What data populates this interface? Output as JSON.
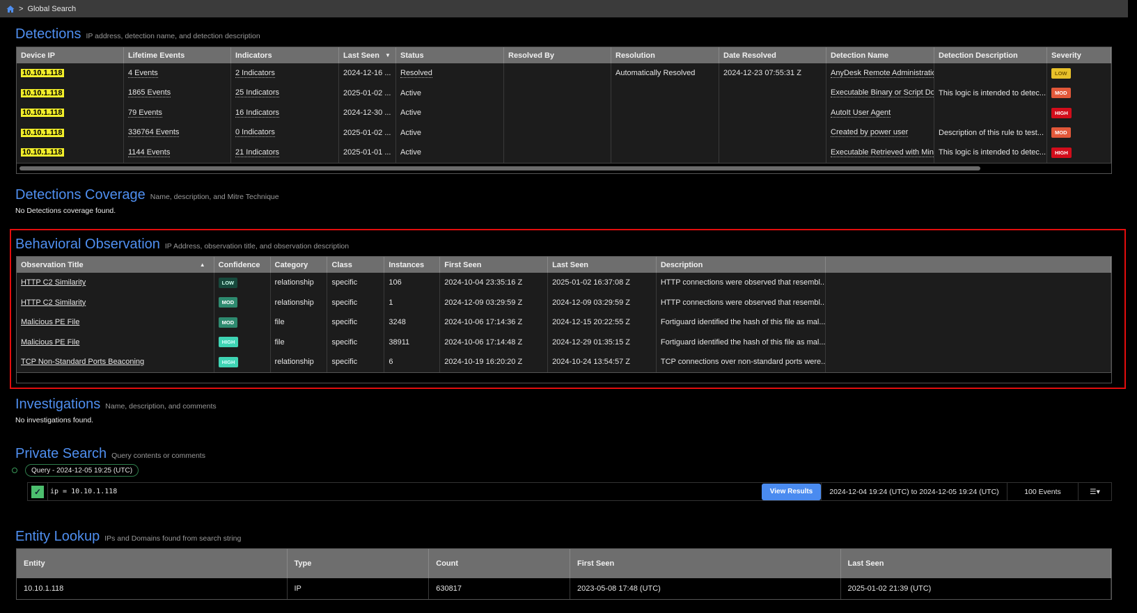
{
  "breadcrumb": {
    "current": "Global Search"
  },
  "detections": {
    "title": "Detections",
    "subtitle": "IP address, detection name, and detection description",
    "columns": [
      "Device IP",
      "Lifetime Events",
      "Indicators",
      "Last Seen",
      "Status",
      "Resolved By",
      "Resolution",
      "Date Resolved",
      "Detection Name",
      "Detection Description",
      "Severity"
    ],
    "rows": [
      [
        "10.10.1.118",
        "4 Events",
        "2 Indicators",
        "2024-12-16 ...",
        "Resolved",
        "",
        "Automatically Resolved",
        "2024-12-23 07:55:31 Z",
        "AnyDesk Remote Administratio",
        "",
        "LOW"
      ],
      [
        "10.10.1.118",
        "1865 Events",
        "25 Indicators",
        "2025-01-02 ...",
        "Active",
        "",
        "",
        "",
        "Executable Binary or Script Dow",
        "This logic is intended to detec...",
        "MOD"
      ],
      [
        "10.10.1.118",
        "79 Events",
        "16 Indicators",
        "2024-12-30 ...",
        "Active",
        "",
        "",
        "",
        "AutoIt User Agent",
        "",
        "HIGH"
      ],
      [
        "10.10.1.118",
        "336764 Events",
        "0 Indicators",
        "2025-01-02 ...",
        "Active",
        "",
        "",
        "",
        "Created by power user",
        "Description of this rule to test...",
        "MOD"
      ],
      [
        "10.10.1.118",
        "1144 Events",
        "21 Indicators",
        "2025-01-01 ...",
        "Active",
        "",
        "",
        "",
        "Executable Retrieved with Minir",
        "This logic is intended to detec...",
        "HIGH"
      ]
    ]
  },
  "coverage": {
    "title": "Detections Coverage",
    "subtitle": "Name, description, and Mitre Technique",
    "empty": "No Detections coverage found."
  },
  "behavioral": {
    "title": "Behavioral Observation",
    "subtitle": "IP Address, observation title, and observation description",
    "columns": [
      "Observation Title",
      "Confidence",
      "Category",
      "Class",
      "Instances",
      "First Seen",
      "Last Seen",
      "Description",
      ""
    ],
    "rows": [
      [
        "HTTP C2 Similarity",
        "LOW",
        "relationship",
        "specific",
        "106",
        "2024-10-04 23:35:16 Z",
        "2025-01-02 16:37:08 Z",
        "HTTP connections were observed that resembl...",
        ""
      ],
      [
        "HTTP C2 Similarity",
        "MOD",
        "relationship",
        "specific",
        "1",
        "2024-12-09 03:29:59 Z",
        "2024-12-09 03:29:59 Z",
        "HTTP connections were observed that resembl...",
        ""
      ],
      [
        "Malicious PE File",
        "MOD",
        "file",
        "specific",
        "3248",
        "2024-10-06 17:14:36 Z",
        "2024-12-15 20:22:55 Z",
        "Fortiguard identified the hash of this file as mal...",
        ""
      ],
      [
        "Malicious PE File",
        "HIGH",
        "file",
        "specific",
        "38911",
        "2024-10-06 17:14:48 Z",
        "2024-12-29 01:35:15 Z",
        "Fortiguard identified the hash of this file as mal...",
        ""
      ],
      [
        "TCP Non-Standard Ports Beaconing",
        "HIGH",
        "relationship",
        "specific",
        "6",
        "2024-10-19 16:20:20 Z",
        "2024-10-24 13:54:57 Z",
        "TCP connections over non-standard ports were...",
        ""
      ]
    ]
  },
  "investigations": {
    "title": "Investigations",
    "subtitle": "Name, description, and comments",
    "empty": "No investigations found."
  },
  "private_search": {
    "title": "Private Search",
    "subtitle": "Query contents or comments",
    "query_label": "Query - 2024-12-05 19:25 (UTC)",
    "query": "ip = 10.10.1.118",
    "view_results": "View Results",
    "range": "2024-12-04 19:24 (UTC) to 2024-12-05 19:24 (UTC)",
    "events": "100 Events"
  },
  "entity": {
    "title": "Entity Lookup",
    "subtitle": "IPs and Domains found from search string",
    "columns": [
      "Entity",
      "Type",
      "Count",
      "First Seen",
      "Last Seen"
    ],
    "rows": [
      [
        "10.10.1.118",
        "IP",
        "630817",
        "2023-05-08 17:48 (UTC)",
        "2025-01-02 21:39 (UTC)"
      ]
    ]
  },
  "colors": {
    "accent": "#4f8ff0",
    "highlight": "#f2ee2a",
    "outline": "#e30d0d"
  }
}
